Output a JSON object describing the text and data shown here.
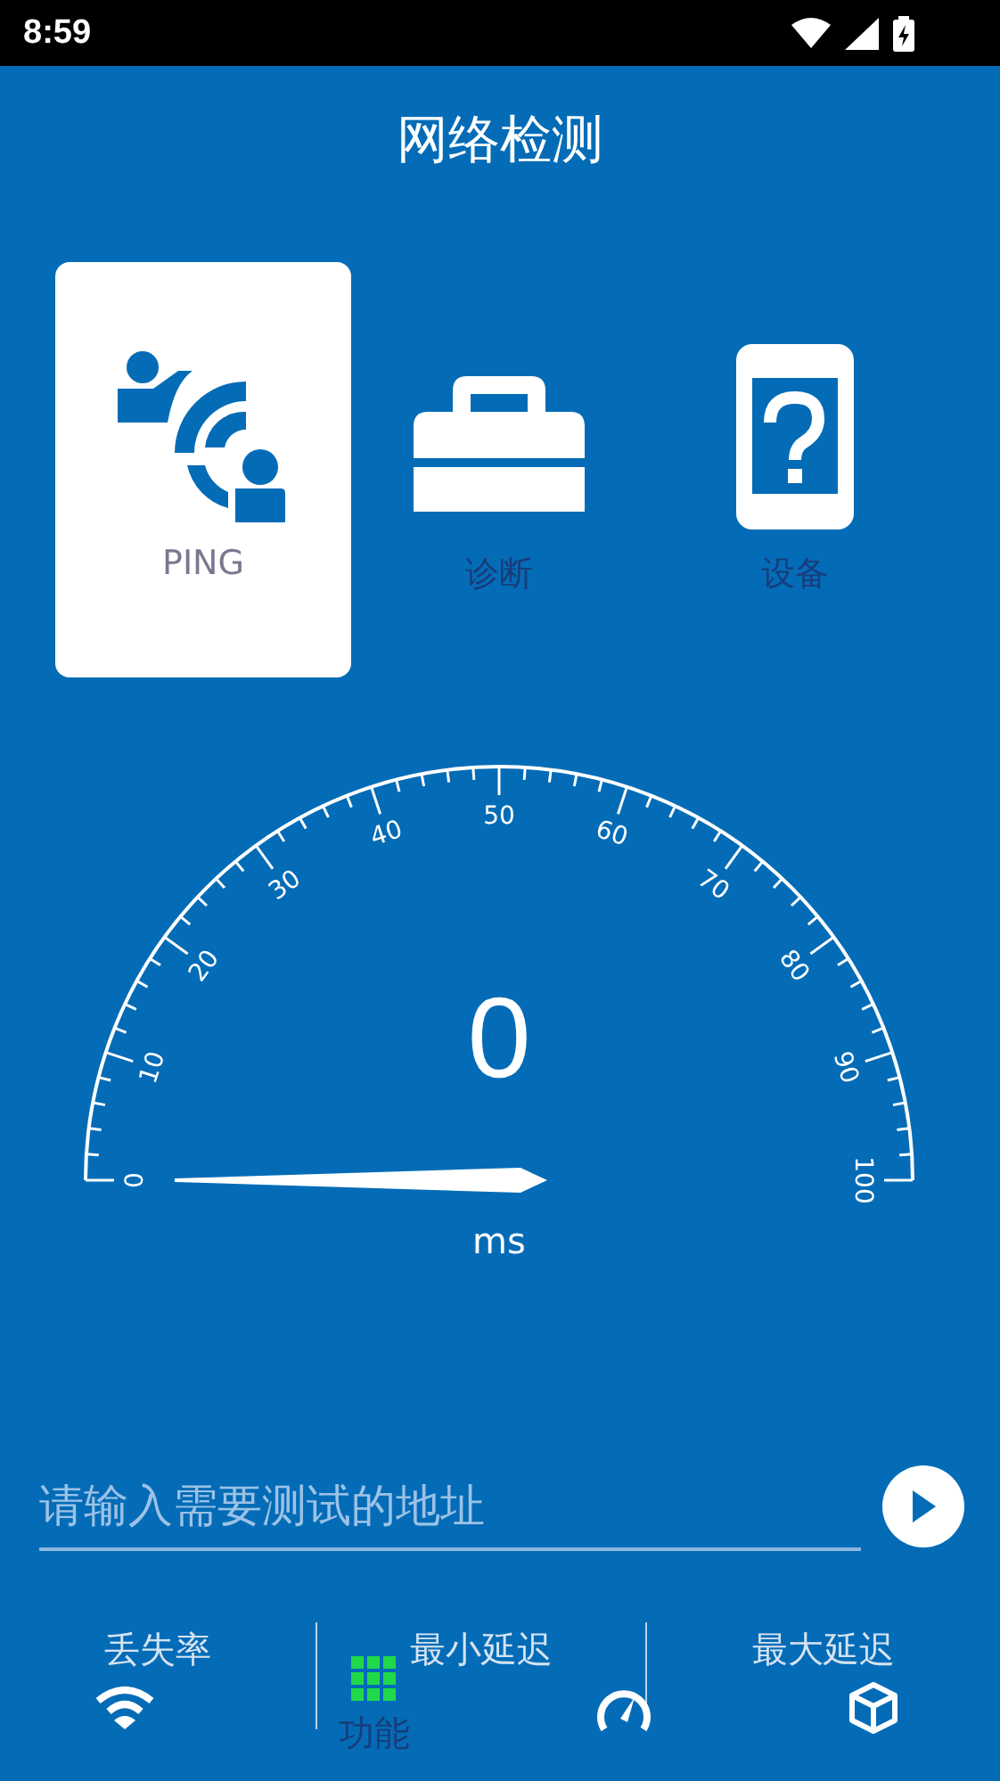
{
  "status_bar": {
    "time": "8:59"
  },
  "title": "网络检测",
  "tools": [
    {
      "kind": "ping",
      "label": "PING",
      "selected": true
    },
    {
      "kind": "toolbox",
      "label": "诊断",
      "selected": false
    },
    {
      "kind": "device",
      "label": "设备",
      "selected": false
    }
  ],
  "gauge": {
    "ticks": [
      "0",
      "10",
      "20",
      "30",
      "40",
      "50",
      "60",
      "70",
      "80",
      "90",
      "100"
    ],
    "value": "0",
    "unit": "ms"
  },
  "address_field": {
    "placeholder": "请输入需要测试的地址"
  },
  "stats": [
    "丢失率",
    "最小延迟",
    "最大延迟"
  ],
  "bottom_nav": [
    {
      "kind": "wifi",
      "selected": false
    },
    {
      "kind": "grid",
      "label": "功能",
      "selected": true
    },
    {
      "kind": "speed",
      "selected": false
    },
    {
      "kind": "cube",
      "selected": false
    }
  ]
}
